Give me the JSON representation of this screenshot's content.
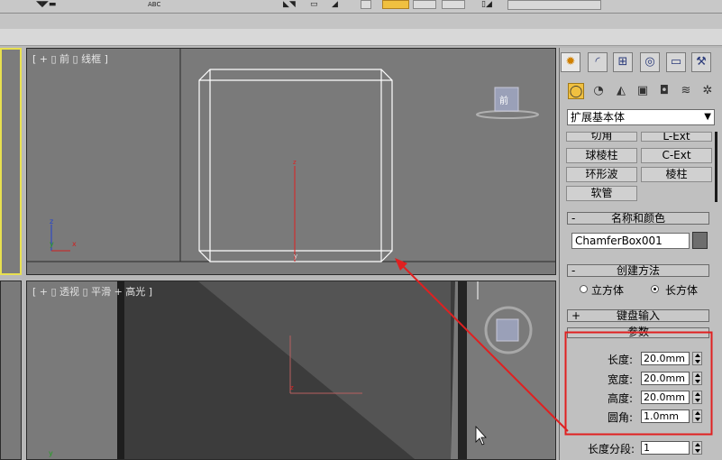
{
  "viewports": {
    "front_label": "[ + ] [ 前 ] [ 线框 ]",
    "front_display": "[ + ▯ 前 ▯ 线框 ]",
    "persp_label": "[ + ▯ 透视 ▯ 平滑 + 高光 ]",
    "viewcube_front": "前"
  },
  "axes": {
    "x": "x",
    "y": "y",
    "z": "z"
  },
  "panel": {
    "category": "扩展基本体",
    "object_buttons": [
      "切角",
      "L-Ext",
      "球棱柱",
      "C-Ext",
      "环形波",
      "棱柱",
      "软管"
    ],
    "name_color_title": "名称和颜色",
    "object_name": "ChamferBox001",
    "object_color": "#6e6e6e",
    "creation_method_title": "创建方法",
    "cube_label": "立方体",
    "box_label": "长方体",
    "keyboard_entry_title": "键盘输入",
    "params_title": "参数",
    "length_label": "长度:",
    "length_value": "20.0mm",
    "width_label": "宽度:",
    "width_value": "20.0mm",
    "height_label": "高度:",
    "height_value": "20.0mm",
    "fillet_label": "圆角:",
    "fillet_value": "1.0mm",
    "length_segs_label": "长度分段:",
    "length_segs_value": "1"
  },
  "annotation": {
    "color": "#e02020"
  }
}
